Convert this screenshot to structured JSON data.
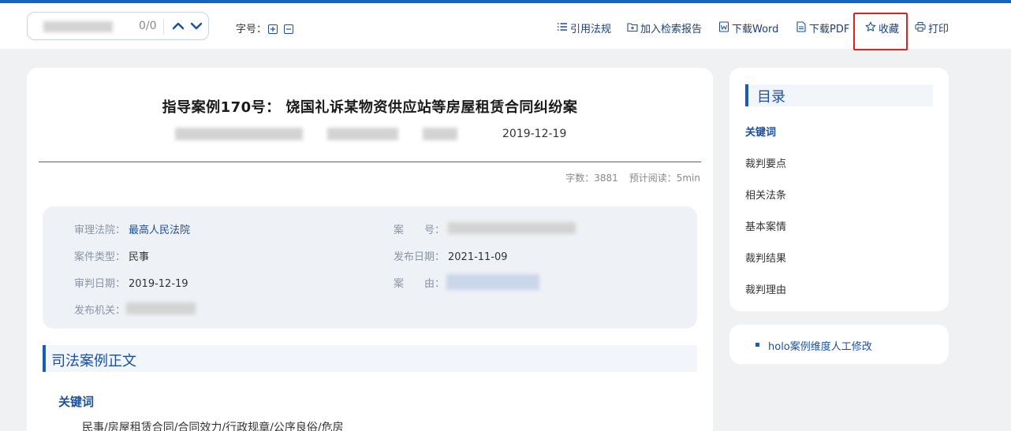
{
  "toolbar": {
    "search_value": "",
    "search_count": "0/0",
    "font_size_label": "字号：",
    "cite_label": "引用法规",
    "add_report_label": "加入检索报告",
    "download_word_label": "下载Word",
    "download_pdf_label": "下载PDF",
    "favorite_label": "收藏",
    "print_label": "打印"
  },
  "document": {
    "title": "指导案例170号： 饶国礼诉某物资供应站等房屋租赁合同纠纷案",
    "date": "2019-12-19",
    "word_count": "字数：3881",
    "read_time": "预计阅读：5min"
  },
  "info": {
    "court_label": "审理法院：",
    "court_value": "最高人民法院",
    "case_no_label": "案　　号：",
    "case_type_label": "案件类型：",
    "case_type_value": "民事",
    "publish_date_label": "发布日期：",
    "publish_date_value": "2021-11-09",
    "trial_date_label": "审判日期：",
    "trial_date_value": "2019-12-19",
    "cause_label": "案　　由：",
    "issuer_label": "发布机关："
  },
  "body": {
    "section_title": "司法案例正文",
    "keywords_heading": "关键词",
    "keywords_text": "民事/房屋租赁合同/合同效力/行政规章/公序良俗/危房"
  },
  "toc": {
    "title": "目录",
    "items": [
      "关键词",
      "裁判要点",
      "相关法条",
      "基本案情",
      "裁判结果",
      "裁判理由"
    ]
  },
  "note": {
    "text": "holo案例维度人工修改"
  },
  "colors": {
    "accent": "#1a4f9c",
    "topline": "#1565c0",
    "highlight_box": "#e51e1e",
    "divider": "#c0392b"
  }
}
